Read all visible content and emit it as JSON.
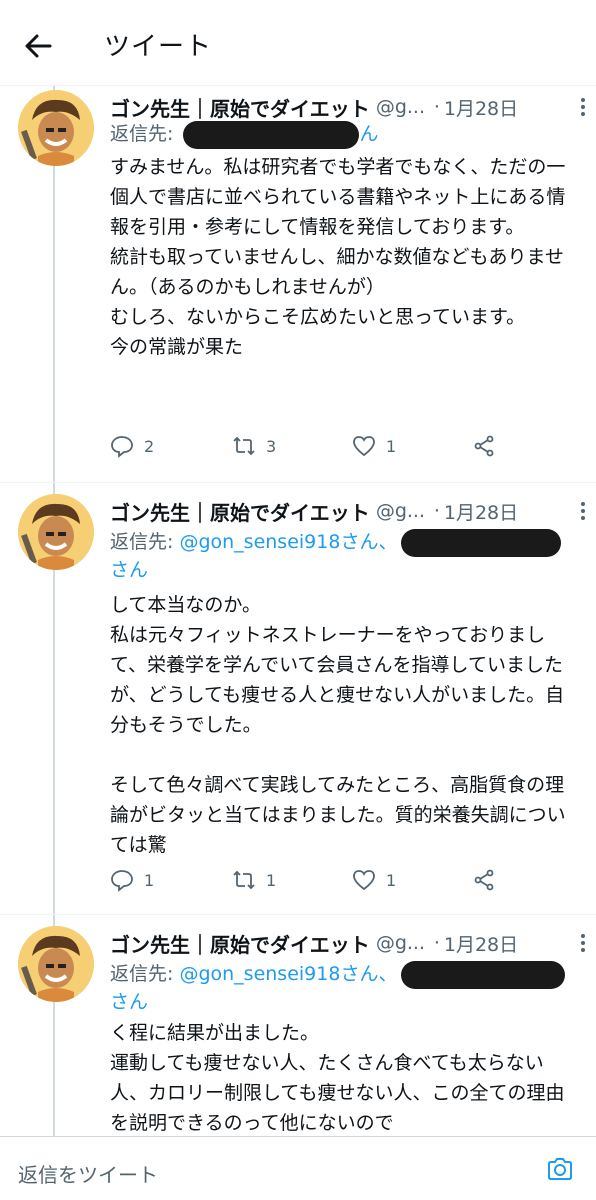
{
  "header": {
    "title": "ツイート"
  },
  "tweets": [
    {
      "author": "ゴン先生｜原始でダイエット",
      "handle": "@g...",
      "dot": "·",
      "date": "1月28日",
      "reply_prefix": "返信先:",
      "reply_mention": "",
      "reply_suffix": "ん",
      "reply_line2": "",
      "text": "すみません。私は研究者でも学者でもなく、ただの一個人で書店に並べられている書籍やネット上にある情報を引用・参考にして情報を発信しております。\n統計も取っていませんし、細かな数値などもありません。（あるのかもしれませんが）\nむしろ、ないからこそ広めたいと思っています。\n今の常識が果た",
      "replies": "2",
      "retweets": "3",
      "likes": "1"
    },
    {
      "author": "ゴン先生｜原始でダイエット",
      "handle": "@g...",
      "dot": "·",
      "date": "1月28日",
      "reply_prefix": "返信先:",
      "reply_mention": "@gon_sensei918さん、",
      "reply_suffix": "",
      "reply_line2": "さん",
      "text": "して本当なのか。\n私は元々フィットネストレーナーをやっておりまして、栄養学を学んでいて会員さんを指導していましたが、どうしても痩せる人と痩せない人がいました。自分もそうでした。\n\nそして色々調べて実践してみたところ、高脂質食の理論がビタッと当てはまりました。質的栄養失調については驚",
      "replies": "1",
      "retweets": "1",
      "likes": "1"
    },
    {
      "author": "ゴン先生｜原始でダイエット",
      "handle": "@g...",
      "dot": "·",
      "date": "1月28日",
      "reply_prefix": "返信先:",
      "reply_mention": "@gon_sensei918さん、",
      "reply_suffix": "",
      "reply_line2": "さん",
      "text": "く程に結果が出ました。\n運動しても痩せない人、たくさん食べても太らない人、カロリー制限しても痩せない人、この全ての理由を説明できるのって他にないので",
      "replies": "",
      "retweets": "",
      "likes": ""
    }
  ],
  "compose": {
    "placeholder": "返信をツイート"
  },
  "colors": {
    "accent": "#1d9bf0",
    "muted": "#536471",
    "avatar_bg": "#f6cf74"
  },
  "icons": [
    "back-arrow-icon",
    "more-icon",
    "reply-icon",
    "retweet-icon",
    "like-icon",
    "share-icon",
    "camera-icon"
  ]
}
